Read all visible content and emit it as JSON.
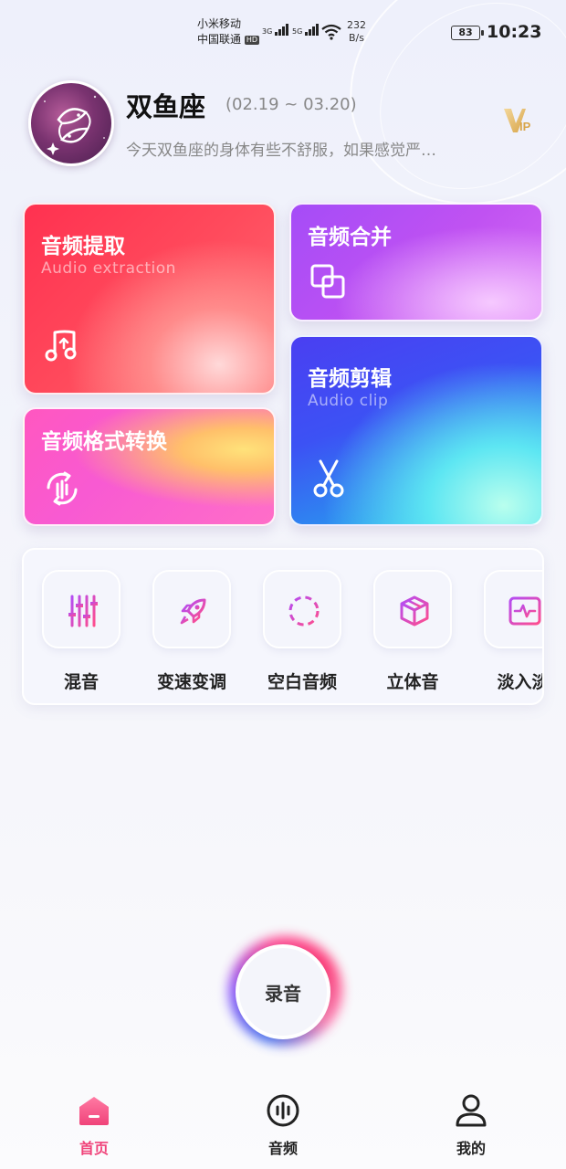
{
  "status_bar": {
    "carrier1": "小米移动",
    "carrier2": "中国联通",
    "hd": "HD",
    "sig1": "3G",
    "sig2": "5G",
    "net_speed_value": "232",
    "net_speed_unit": "B/s",
    "battery": "83",
    "time": "10:23"
  },
  "header": {
    "sign_name": "双鱼座",
    "sign_dates": "(02.19 ~ 03.20)",
    "sign_desc": "今天双鱼座的身体有些不舒服，如果感觉严…",
    "vip_icon": "vip-badge-icon"
  },
  "cards": {
    "extract": {
      "title": "音频提取",
      "subtitle": "Audio extraction",
      "icon": "music-file-icon"
    },
    "merge": {
      "title": "音频合并",
      "icon": "overlap-squares-icon"
    },
    "convert": {
      "title": "音频格式转换",
      "icon": "convert-wave-icon"
    },
    "clip": {
      "title": "音频剪辑",
      "subtitle": "Audio clip",
      "icon": "scissors-icon"
    }
  },
  "tools": [
    {
      "label": "混音",
      "icon": "mixer-sliders-icon"
    },
    {
      "label": "变速变调",
      "icon": "rocket-icon"
    },
    {
      "label": "空白音频",
      "icon": "dashed-circle-icon"
    },
    {
      "label": "立体音",
      "icon": "cube-icon"
    },
    {
      "label": "淡入淡",
      "icon": "waveform-box-icon"
    }
  ],
  "record": {
    "label": "录音"
  },
  "nav": {
    "items": [
      {
        "label": "首页",
        "icon": "home-icon",
        "active": true
      },
      {
        "label": "音频",
        "icon": "audio-wave-icon",
        "active": false
      },
      {
        "label": "我的",
        "icon": "user-icon",
        "active": false
      }
    ],
    "active_color": "#f0437a"
  },
  "colors": {
    "card_extract": "#ff3150",
    "card_merge": "#b050f5",
    "card_convert": "#ff57c0",
    "card_clip": "#3c52f4",
    "tool_icon_gradient_start": "#b44cf3",
    "tool_icon_gradient_end": "#ff4d8d"
  }
}
